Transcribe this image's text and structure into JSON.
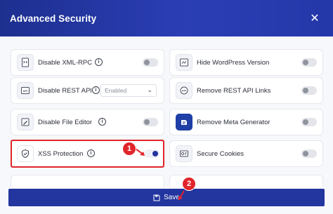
{
  "header": {
    "title": "Advanced Security"
  },
  "left": [
    {
      "label": "Disable XML-RPC",
      "icon": "xml-file-icon",
      "toggle_on": false
    },
    {
      "label": "Disable REST API",
      "icon": "api-icon",
      "select_value": "Enabled"
    },
    {
      "label": "Disable File Editor",
      "icon": "file-editor-icon",
      "toggle_on": false
    },
    {
      "label": "XSS Protection",
      "icon": "shield-icon",
      "toggle_on": true
    }
  ],
  "right": [
    {
      "label": "Hide WordPress Version",
      "icon": "version-icon",
      "toggle_on": false
    },
    {
      "label": "Remove REST API Links",
      "icon": "api-links-icon",
      "toggle_on": false
    },
    {
      "label": "Remove Meta Generator",
      "icon": "meta-generator-icon",
      "toggle_on": false
    },
    {
      "label": "Secure Cookies",
      "icon": "cookie-icon",
      "toggle_on": false
    }
  ],
  "annotations": {
    "step1": "1",
    "step2": "2"
  },
  "footer": {
    "save_label": "Save"
  },
  "colors": {
    "header": "#23359f",
    "accent": "#23359f",
    "highlight": "#e0252b"
  }
}
